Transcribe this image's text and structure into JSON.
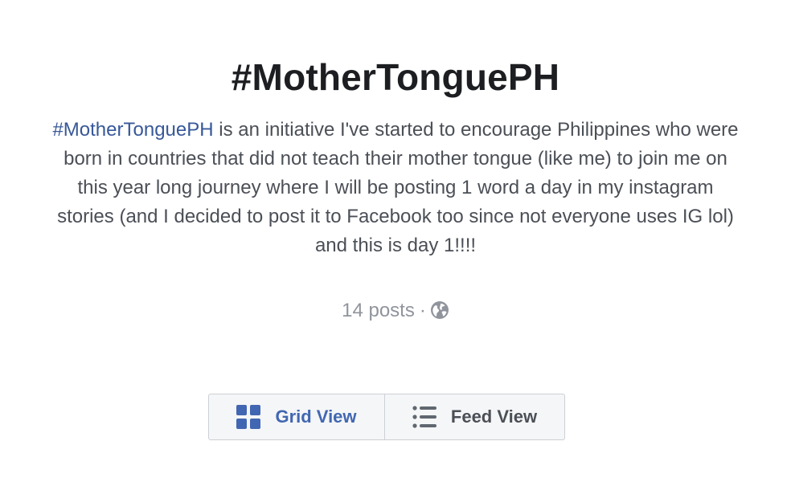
{
  "hashtag_page": {
    "title": "#MotherTonguePH",
    "description_link": "#MotherTonguePH",
    "description_text": " is an initiative I've started to encourage Philippines who were born in countries that did not teach their mother tongue (like me) to join me on this year long journey where I will be posting 1 word a day in my instagram stories (and I decided to post it to Facebook too since not everyone uses IG lol) and this is day 1!!!!",
    "post_count": "14 posts",
    "separator": "·",
    "privacy_icon": "globe-icon"
  },
  "view_toggle": {
    "grid_label": "Grid View",
    "grid_icon": "grid-icon",
    "feed_label": "Feed View",
    "feed_icon": "list-icon",
    "active": "grid"
  },
  "colors": {
    "title": "#1c1e21",
    "text": "#4b4f56",
    "link": "#385898",
    "meta": "#90949c",
    "active_tab": "#4267b2",
    "toggle_bg": "#f5f6f7",
    "toggle_border": "#ccd0d5"
  }
}
